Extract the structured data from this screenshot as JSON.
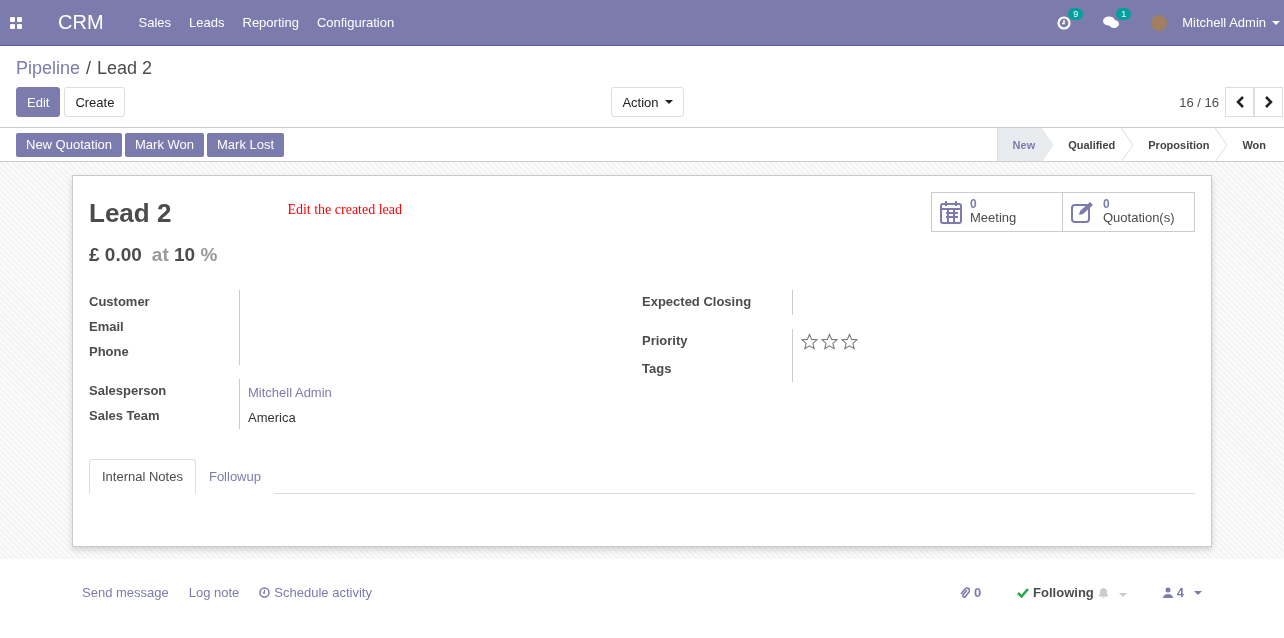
{
  "navbar": {
    "app_name": "CRM",
    "menu": [
      "Sales",
      "Leads",
      "Reporting",
      "Configuration"
    ],
    "activity_count": "9",
    "message_count": "1",
    "user": "Mitchell Admin"
  },
  "breadcrumb": {
    "parent": "Pipeline",
    "separator": "/",
    "current": "Lead 2"
  },
  "control_buttons": {
    "edit": "Edit",
    "create": "Create",
    "action": "Action",
    "pager": "16 / 16"
  },
  "header_buttons": [
    "New Quotation",
    "Mark Won",
    "Mark Lost"
  ],
  "stages": [
    {
      "label": "New",
      "selected": true
    },
    {
      "label": "Qualified",
      "selected": false
    },
    {
      "label": "Proposition",
      "selected": false
    },
    {
      "label": "Won",
      "selected": false
    }
  ],
  "sheet": {
    "title": "Lead 2",
    "annotation": "Edit the created lead",
    "revenue": "£ 0.00",
    "at": "at",
    "probability": "10",
    "percent": "%"
  },
  "smart_buttons": [
    {
      "kind": "calendar",
      "count": "0",
      "label": "Meeting"
    },
    {
      "kind": "edit",
      "count": "0",
      "label": "Quotation(s)"
    }
  ],
  "left_groups": [
    [
      {
        "label": "Customer"
      },
      {
        "label": "Email"
      },
      {
        "label": "Phone"
      }
    ],
    [
      {
        "label": "Salesperson",
        "value": "Mitchell Admin",
        "link": true
      },
      {
        "label": "Sales Team",
        "value": "America",
        "link": false
      }
    ]
  ],
  "right_groups": [
    [
      {
        "label": "Expected Closing"
      }
    ],
    [
      {
        "label": "Priority",
        "kind": "stars",
        "stars": 0
      },
      {
        "label": "Tags",
        "kind": "text"
      }
    ]
  ],
  "tabs": [
    {
      "label": "Internal Notes",
      "selected": true
    },
    {
      "label": "Followup",
      "selected": false
    }
  ],
  "chatter": {
    "send": "Send message",
    "log": "Log note",
    "schedule": "Schedule activity",
    "attachments": "0",
    "following": "Following",
    "followers": "4"
  }
}
